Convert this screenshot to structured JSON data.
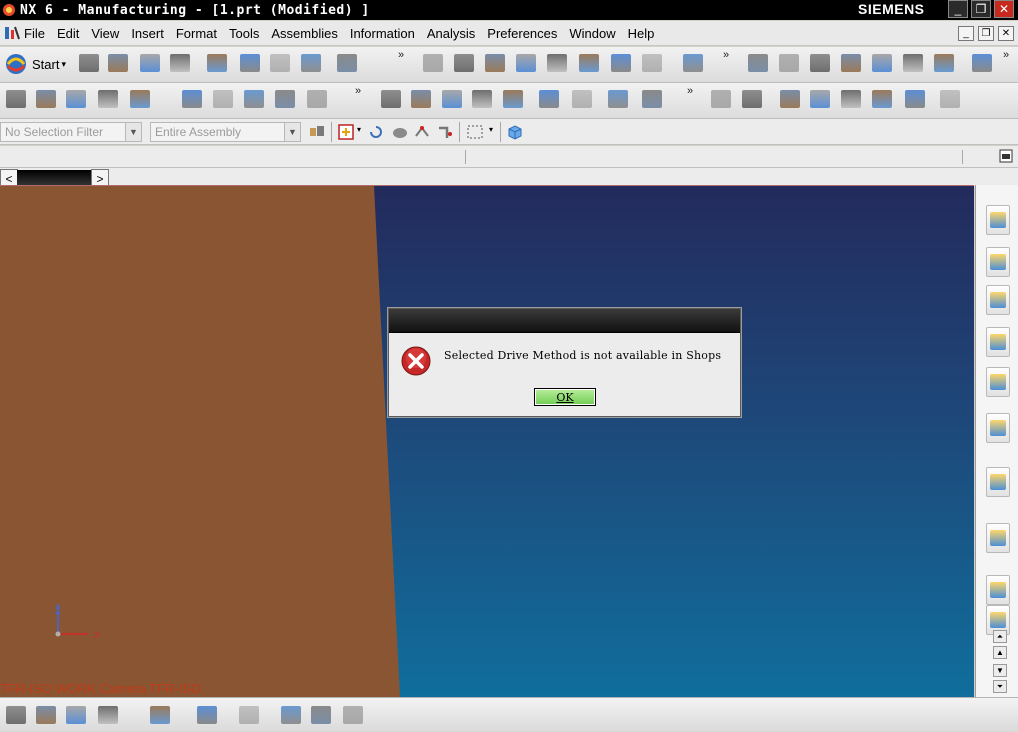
{
  "window": {
    "title": "NX 6 - Manufacturing - [1.prt (Modified) ]",
    "brand": "SIEMENS",
    "minimize_glyph": "_",
    "restore_glyph": "❐",
    "close_glyph": "✕"
  },
  "menubar": {
    "items": [
      "File",
      "Edit",
      "View",
      "Insert",
      "Format",
      "Tools",
      "Assemblies",
      "Information",
      "Analysis",
      "Preferences",
      "Window",
      "Help"
    ]
  },
  "toolbar": {
    "start_label": "Start",
    "icons_row1": [
      "new-icon",
      "open-icon",
      "save-icon",
      "print-icon",
      "cut-icon",
      "copy-icon",
      "paste-icon",
      "delete-icon",
      "undo-icon",
      "fit-icon",
      "zoom-window-icon",
      "zoom-icon",
      "pan-icon",
      "rotate-icon",
      "refresh-icon",
      "view-orient-icon",
      "shaded-icon",
      "render-style-icon",
      "wcs-icon",
      "operation-navigator-icon",
      "machine-tool-icon",
      "tool-path-icon",
      "verify-icon",
      "postprocess-icon",
      "shop-docs-icon",
      "measure-icon"
    ],
    "icons_row2": [
      "create-program-icon",
      "create-tool-icon",
      "create-geometry-icon",
      "create-method-icon",
      "create-operation-icon",
      "generate-icon",
      "replay-icon",
      "list-icon",
      "verify-tool-path-icon",
      "post-icon",
      "edit-icon",
      "cut-operation-icon",
      "copy-operation-icon",
      "paste-operation-icon",
      "delete-operation-icon",
      "display-icon",
      "clamp-icon",
      "sim-icon",
      "report-icon",
      "feature-icon",
      "machine-kit-icon",
      "probe-icon",
      "gauge-icon",
      "fixture-icon",
      "align-icon",
      "stock-icon",
      "close-operation-icon"
    ]
  },
  "filterbar": {
    "selection_filter": "No Selection Filter",
    "scope": "Entire Assembly"
  },
  "viewport": {
    "view_label": "TFR-ISO WORK Camera TFR-ISO",
    "triad_x": "X",
    "triad_z": "Z"
  },
  "dialog": {
    "message": "Selected Drive Method is not available in Shops",
    "ok_label": "OK"
  },
  "resource_bar": {
    "tabs": [
      "assembly-navigator-icon",
      "constraint-navigator-icon",
      "part-navigator-icon",
      "reuse-library-icon",
      "hd3d-tools-icon",
      "web-browser-icon",
      "history-icon",
      "system-materials-icon",
      "palette-icon",
      "roles-icon"
    ]
  },
  "colors": {
    "brand_title_bg": "#000000",
    "viewport_top": "#232a5c",
    "viewport_bottom": "#106e9c",
    "part_face": "#8a5532",
    "view_label": "#c03a17",
    "ok_button": "#6fcc52",
    "error_icon": "#c62828"
  }
}
